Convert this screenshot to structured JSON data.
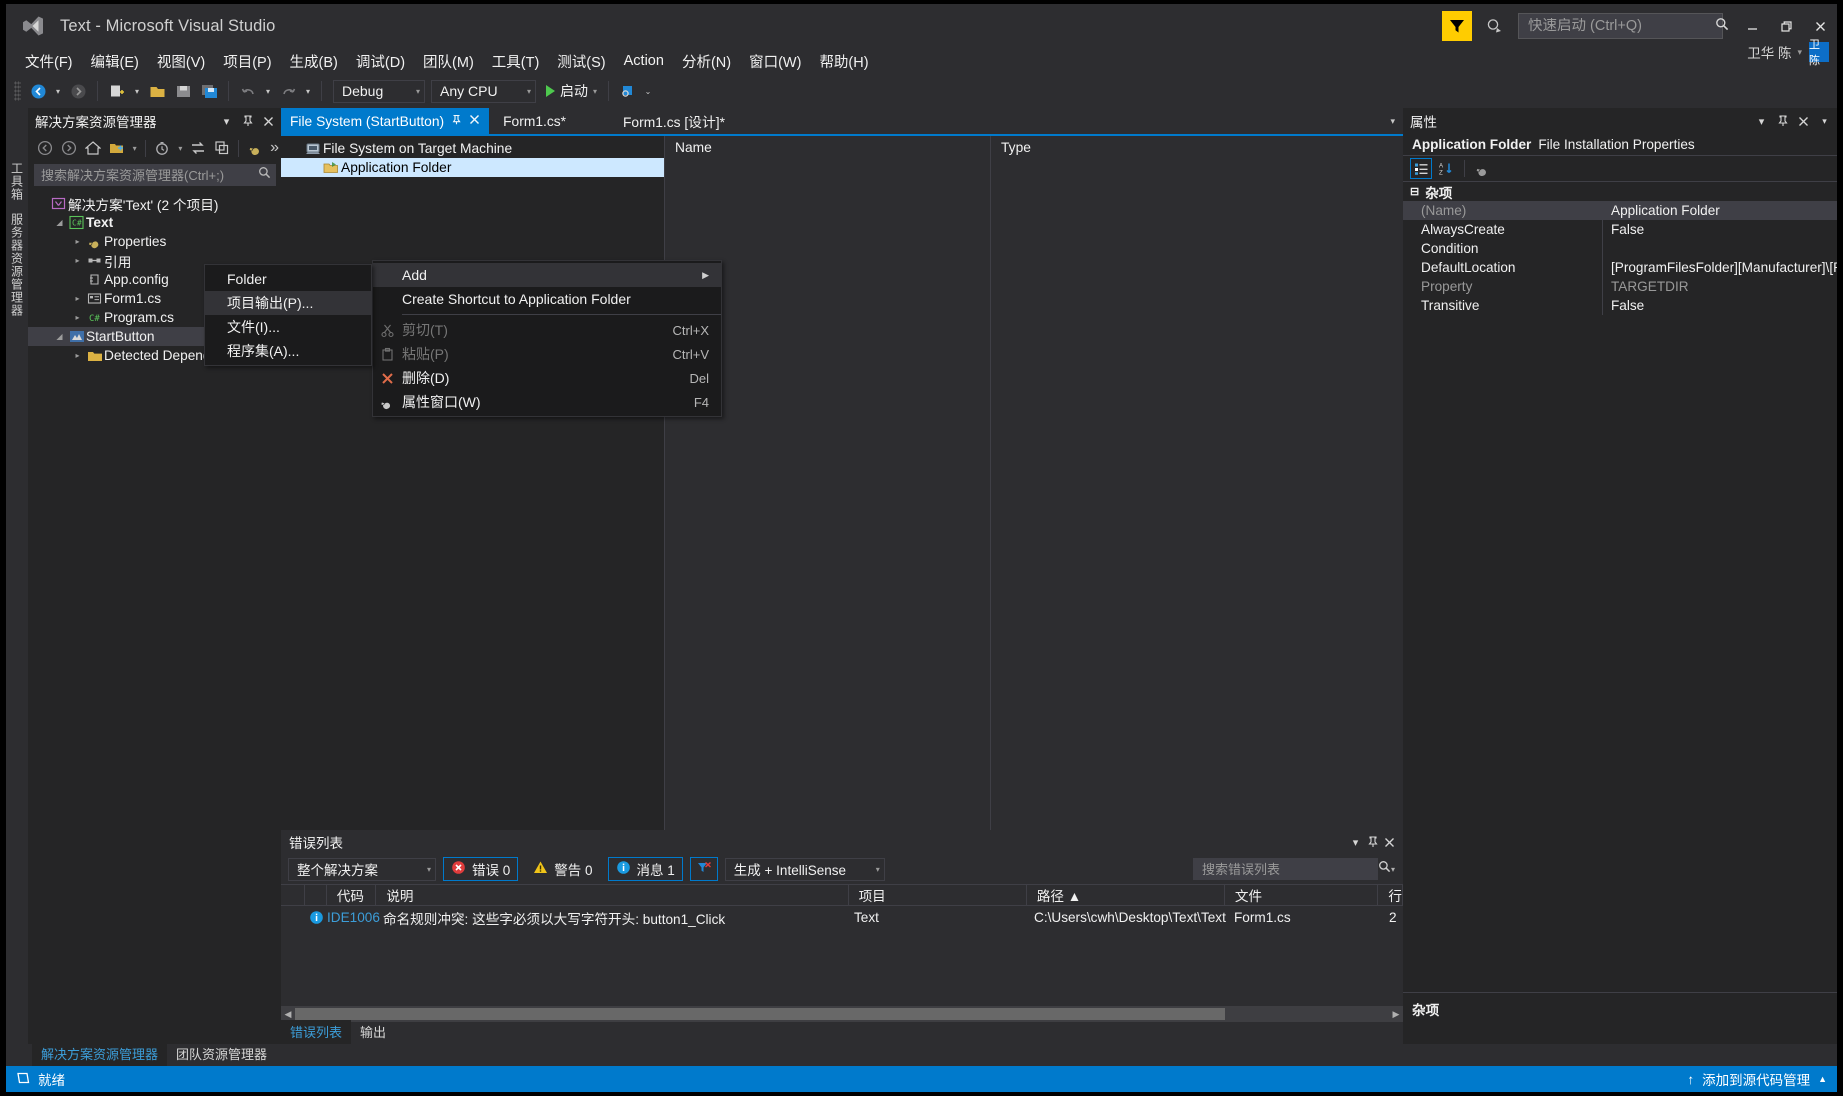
{
  "window": {
    "title": "Text - Microsoft Visual Studio",
    "logo_icon": "visual-studio-logo",
    "minimize": "—",
    "restore": "❐",
    "close": "✕"
  },
  "titlebar": {
    "feedback_icon": "feedback-funnel-icon",
    "send_smile_icon": "send-feedback-icon",
    "quick_launch_placeholder": "快速启动 (Ctrl+Q)",
    "quick_launch_value": "",
    "search_icon": "search-icon",
    "user_name": "卫华 陈",
    "user_caret": "▾",
    "avatar_text": "卫陈"
  },
  "menubar": {
    "items": [
      "文件(F)",
      "编辑(E)",
      "视图(V)",
      "项目(P)",
      "生成(B)",
      "调试(D)",
      "团队(M)",
      "工具(T)",
      "测试(S)",
      "Action",
      "分析(N)",
      "窗口(W)",
      "帮助(H)"
    ]
  },
  "toolbar": {
    "nav_back_icon": "navigate-back-icon",
    "nav_forward_icon": "navigate-forward-icon",
    "new_project_icon": "new-project-icon",
    "open_file_icon": "open-file-icon",
    "save_icon": "save-icon",
    "save_all_icon": "save-all-icon",
    "undo_icon": "undo-icon",
    "redo_icon": "redo-icon",
    "config_value": "Debug",
    "platform_value": "Any CPU",
    "start_label": "启动",
    "start_icon": "play-icon",
    "attach_icon": "attach-process-icon",
    "overflow_icon": "toolbar-overflow-icon"
  },
  "vertical_tabs": {
    "items": [
      "工具箱",
      "服务器资源管理器"
    ]
  },
  "solution_explorer": {
    "title": "解决方案资源管理器",
    "header_icons": [
      "chevron-down-icon",
      "pin-icon",
      "close-icon"
    ],
    "toolbar_icons": [
      "back-icon",
      "forward-icon",
      "home-icon",
      "show-all-files-icon",
      "pending-changes-icon",
      "sync-icon",
      "collapse-all-icon",
      "properties-icon"
    ],
    "search_placeholder": "搜索解决方案资源管理器(Ctrl+;)",
    "search_value": "",
    "tree": [
      {
        "label": "解决方案'Text' (2 个项目)",
        "icon": "solution-icon",
        "indent": 0,
        "twisty": "",
        "bold": false
      },
      {
        "label": "Text",
        "icon": "csharp-project-icon",
        "indent": 1,
        "twisty": "▲",
        "bold": true
      },
      {
        "label": "Properties",
        "icon": "wrench-icon",
        "indent": 2,
        "twisty": "▶",
        "bold": false
      },
      {
        "label": "引用",
        "icon": "references-icon",
        "indent": 2,
        "twisty": "▶",
        "bold": false
      },
      {
        "label": "App.config",
        "icon": "config-icon",
        "indent": 2,
        "twisty": "",
        "bold": false
      },
      {
        "label": "Form1.cs",
        "icon": "form-icon",
        "indent": 2,
        "twisty": "▶",
        "bold": false
      },
      {
        "label": "Program.cs",
        "icon": "csharp-file-icon",
        "indent": 2,
        "twisty": "▶",
        "bold": false
      },
      {
        "label": "StartButton",
        "icon": "setup-project-icon",
        "indent": 1,
        "twisty": "▲",
        "bold": false,
        "selected": true
      },
      {
        "label": "Detected Dependencies",
        "icon": "folder-icon",
        "indent": 2,
        "twisty": "▶",
        "bold": false
      }
    ]
  },
  "document_tabs": {
    "tabs": [
      {
        "label": "File System (StartButton)",
        "active": true,
        "pin_icon": "pin-icon",
        "close_icon": "close-icon"
      },
      {
        "label": "Form1.cs*",
        "active": false
      },
      {
        "label": "Form1.cs [设计]*",
        "active": false
      }
    ],
    "overflow_icon": "chevron-down-icon"
  },
  "file_system_editor": {
    "tree": [
      {
        "label": "File System on Target Machine",
        "icon": "computer-icon",
        "indent": 0,
        "selected": false
      },
      {
        "label": "Application Folder",
        "icon": "folder-open-icon",
        "indent": 1,
        "selected": true
      }
    ],
    "columns": [
      "Name",
      "Type"
    ],
    "rows": []
  },
  "context_menu_main": {
    "items": [
      {
        "label": "Add",
        "icon": "",
        "key": "",
        "submenu": true,
        "highlighted": true,
        "disabled": false
      },
      {
        "label": "Create Shortcut to Application Folder",
        "icon": "",
        "key": "",
        "submenu": false,
        "highlighted": false,
        "disabled": false
      },
      {
        "separator": true
      },
      {
        "label": "剪切(T)",
        "icon": "cut-icon",
        "key": "Ctrl+X",
        "submenu": false,
        "highlighted": false,
        "disabled": true
      },
      {
        "label": "粘贴(P)",
        "icon": "paste-icon",
        "key": "Ctrl+V",
        "submenu": false,
        "highlighted": false,
        "disabled": true
      },
      {
        "label": "删除(D)",
        "icon": "delete-icon",
        "key": "Del",
        "submenu": false,
        "highlighted": false,
        "disabled": false
      },
      {
        "label": "属性窗口(W)",
        "icon": "properties-window-icon",
        "key": "F4",
        "submenu": false,
        "highlighted": false,
        "disabled": false
      }
    ]
  },
  "context_menu_sub": {
    "items": [
      {
        "label": "Folder",
        "highlighted": false
      },
      {
        "label": "项目输出(P)...",
        "highlighted": true
      },
      {
        "label": "文件(I)...",
        "highlighted": false
      },
      {
        "label": "程序集(A)...",
        "highlighted": false
      }
    ]
  },
  "error_list": {
    "title": "错误列表",
    "header_icons": [
      "chevron-down-icon",
      "pin-icon",
      "close-icon"
    ],
    "scope_value": "整个解决方案",
    "errors_label": "错误 0",
    "errors_icon": "error-icon",
    "warnings_label": "警告 0",
    "warnings_icon": "warning-icon",
    "messages_label": "消息 1",
    "messages_icon": "info-icon",
    "filter_icon": "clear-filter-icon",
    "build_filter_value": "生成 + IntelliSense",
    "search_placeholder": "搜索错误列表",
    "search_value": "",
    "search_icon": "search-icon",
    "search_caret": "▾",
    "columns": [
      "",
      "",
      "代码",
      "说明",
      "项目",
      "路径 ▲",
      "文件",
      "行"
    ],
    "rows": [
      {
        "severity_icon": "info-icon",
        "code": "IDE1006",
        "description": "命名规则冲突: 这些字必须以大写字符开头: button1_Click",
        "project": "Text",
        "path": "C:\\Users\\cwh\\Desktop\\Text\\Text",
        "file": "Form1.cs",
        "line": "2"
      }
    ]
  },
  "properties_pane": {
    "title": "属性",
    "header_icons": [
      "chevron-down-icon",
      "pin-icon",
      "close-icon"
    ],
    "object_name": "Application Folder",
    "object_type": "File Installation Properties",
    "toolbar_icons": [
      "categorized-icon",
      "alphabetical-icon",
      "property-pages-icon"
    ],
    "category": "杂项",
    "category_expander": "⊟",
    "rows": [
      {
        "name": "(Name)",
        "value": "Application Folder",
        "dim_name": true,
        "dim_value": false,
        "highlight": true
      },
      {
        "name": "AlwaysCreate",
        "value": "False",
        "dim_name": false,
        "dim_value": false,
        "highlight": false
      },
      {
        "name": "Condition",
        "value": "",
        "dim_name": false,
        "dim_value": false,
        "highlight": false
      },
      {
        "name": "DefaultLocation",
        "value": "[ProgramFilesFolder][Manufacturer]\\[P",
        "dim_name": false,
        "dim_value": false,
        "highlight": false
      },
      {
        "name": "Property",
        "value": "TARGETDIR",
        "dim_name": true,
        "dim_value": true,
        "highlight": false
      },
      {
        "name": "Transitive",
        "value": "False",
        "dim_name": false,
        "dim_value": false,
        "highlight": false
      }
    ],
    "footer_title": "杂项"
  },
  "bottom_tabs": {
    "left": [
      {
        "label": "解决方案资源管理器",
        "active": true
      },
      {
        "label": "团队资源管理器",
        "active": false
      }
    ],
    "center": [
      {
        "label": "错误列表",
        "active": true
      },
      {
        "label": "输出",
        "active": false
      }
    ]
  },
  "statusbar": {
    "status_icon": "ready-icon",
    "status_text": "就绪",
    "source_control_icon": "up-arrow-icon",
    "source_control_text": "添加到源代码管理",
    "source_control_caret": "▲"
  }
}
